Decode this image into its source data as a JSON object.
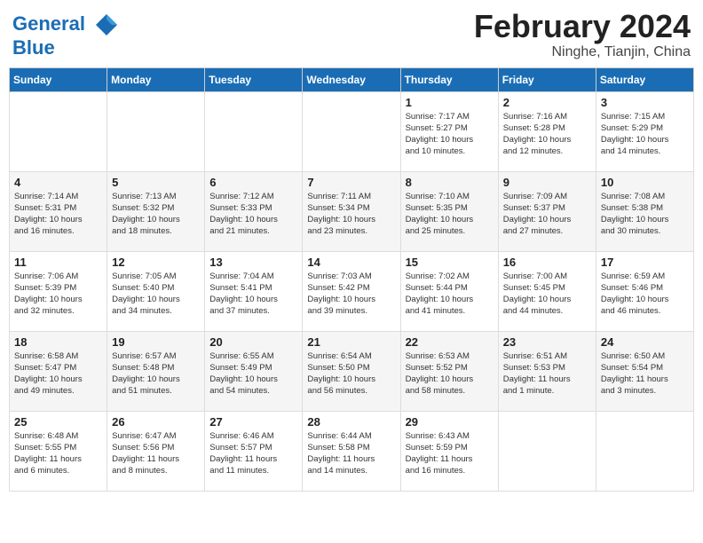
{
  "logo": {
    "line1": "General",
    "line2": "Blue"
  },
  "title": "February 2024",
  "location": "Ninghe, Tianjin, China",
  "days_of_week": [
    "Sunday",
    "Monday",
    "Tuesday",
    "Wednesday",
    "Thursday",
    "Friday",
    "Saturday"
  ],
  "weeks": [
    [
      {
        "day": "",
        "info": ""
      },
      {
        "day": "",
        "info": ""
      },
      {
        "day": "",
        "info": ""
      },
      {
        "day": "",
        "info": ""
      },
      {
        "day": "1",
        "info": "Sunrise: 7:17 AM\nSunset: 5:27 PM\nDaylight: 10 hours\nand 10 minutes."
      },
      {
        "day": "2",
        "info": "Sunrise: 7:16 AM\nSunset: 5:28 PM\nDaylight: 10 hours\nand 12 minutes."
      },
      {
        "day": "3",
        "info": "Sunrise: 7:15 AM\nSunset: 5:29 PM\nDaylight: 10 hours\nand 14 minutes."
      }
    ],
    [
      {
        "day": "4",
        "info": "Sunrise: 7:14 AM\nSunset: 5:31 PM\nDaylight: 10 hours\nand 16 minutes."
      },
      {
        "day": "5",
        "info": "Sunrise: 7:13 AM\nSunset: 5:32 PM\nDaylight: 10 hours\nand 18 minutes."
      },
      {
        "day": "6",
        "info": "Sunrise: 7:12 AM\nSunset: 5:33 PM\nDaylight: 10 hours\nand 21 minutes."
      },
      {
        "day": "7",
        "info": "Sunrise: 7:11 AM\nSunset: 5:34 PM\nDaylight: 10 hours\nand 23 minutes."
      },
      {
        "day": "8",
        "info": "Sunrise: 7:10 AM\nSunset: 5:35 PM\nDaylight: 10 hours\nand 25 minutes."
      },
      {
        "day": "9",
        "info": "Sunrise: 7:09 AM\nSunset: 5:37 PM\nDaylight: 10 hours\nand 27 minutes."
      },
      {
        "day": "10",
        "info": "Sunrise: 7:08 AM\nSunset: 5:38 PM\nDaylight: 10 hours\nand 30 minutes."
      }
    ],
    [
      {
        "day": "11",
        "info": "Sunrise: 7:06 AM\nSunset: 5:39 PM\nDaylight: 10 hours\nand 32 minutes."
      },
      {
        "day": "12",
        "info": "Sunrise: 7:05 AM\nSunset: 5:40 PM\nDaylight: 10 hours\nand 34 minutes."
      },
      {
        "day": "13",
        "info": "Sunrise: 7:04 AM\nSunset: 5:41 PM\nDaylight: 10 hours\nand 37 minutes."
      },
      {
        "day": "14",
        "info": "Sunrise: 7:03 AM\nSunset: 5:42 PM\nDaylight: 10 hours\nand 39 minutes."
      },
      {
        "day": "15",
        "info": "Sunrise: 7:02 AM\nSunset: 5:44 PM\nDaylight: 10 hours\nand 41 minutes."
      },
      {
        "day": "16",
        "info": "Sunrise: 7:00 AM\nSunset: 5:45 PM\nDaylight: 10 hours\nand 44 minutes."
      },
      {
        "day": "17",
        "info": "Sunrise: 6:59 AM\nSunset: 5:46 PM\nDaylight: 10 hours\nand 46 minutes."
      }
    ],
    [
      {
        "day": "18",
        "info": "Sunrise: 6:58 AM\nSunset: 5:47 PM\nDaylight: 10 hours\nand 49 minutes."
      },
      {
        "day": "19",
        "info": "Sunrise: 6:57 AM\nSunset: 5:48 PM\nDaylight: 10 hours\nand 51 minutes."
      },
      {
        "day": "20",
        "info": "Sunrise: 6:55 AM\nSunset: 5:49 PM\nDaylight: 10 hours\nand 54 minutes."
      },
      {
        "day": "21",
        "info": "Sunrise: 6:54 AM\nSunset: 5:50 PM\nDaylight: 10 hours\nand 56 minutes."
      },
      {
        "day": "22",
        "info": "Sunrise: 6:53 AM\nSunset: 5:52 PM\nDaylight: 10 hours\nand 58 minutes."
      },
      {
        "day": "23",
        "info": "Sunrise: 6:51 AM\nSunset: 5:53 PM\nDaylight: 11 hours\nand 1 minute."
      },
      {
        "day": "24",
        "info": "Sunrise: 6:50 AM\nSunset: 5:54 PM\nDaylight: 11 hours\nand 3 minutes."
      }
    ],
    [
      {
        "day": "25",
        "info": "Sunrise: 6:48 AM\nSunset: 5:55 PM\nDaylight: 11 hours\nand 6 minutes."
      },
      {
        "day": "26",
        "info": "Sunrise: 6:47 AM\nSunset: 5:56 PM\nDaylight: 11 hours\nand 8 minutes."
      },
      {
        "day": "27",
        "info": "Sunrise: 6:46 AM\nSunset: 5:57 PM\nDaylight: 11 hours\nand 11 minutes."
      },
      {
        "day": "28",
        "info": "Sunrise: 6:44 AM\nSunset: 5:58 PM\nDaylight: 11 hours\nand 14 minutes."
      },
      {
        "day": "29",
        "info": "Sunrise: 6:43 AM\nSunset: 5:59 PM\nDaylight: 11 hours\nand 16 minutes."
      },
      {
        "day": "",
        "info": ""
      },
      {
        "day": "",
        "info": ""
      }
    ]
  ]
}
